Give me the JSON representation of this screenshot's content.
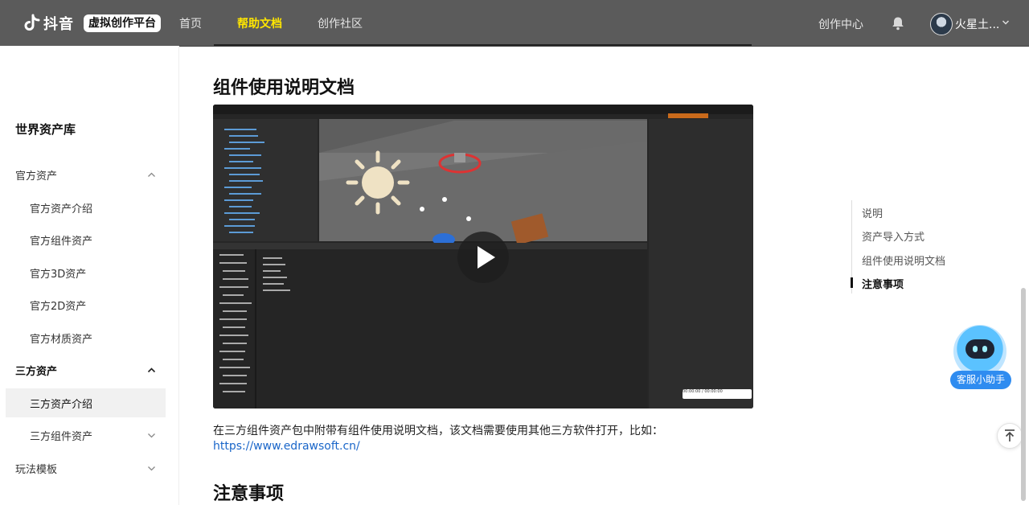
{
  "header": {
    "brand": "抖音",
    "badge": "虚拟创作平台",
    "nav": [
      "首页",
      "帮助文档",
      "创作社区"
    ],
    "active_nav": "帮助文档",
    "create_center": "创作中心",
    "username": "火星土..."
  },
  "sidebar": {
    "title": "世界资产库",
    "groups": [
      {
        "label": "官方资产",
        "expanded": true,
        "items": [
          "官方资产介绍",
          "官方组件资产",
          "官方3D资产",
          "官方2D资产",
          "官方材质资产"
        ]
      },
      {
        "label": "三方资产",
        "expanded": true,
        "items": [
          "三方资产介绍",
          "三方组件资产"
        ]
      },
      {
        "label": "玩法模板",
        "expanded": false,
        "items": []
      }
    ],
    "selected": "三方资产介绍"
  },
  "content": {
    "section_title": "组件使用说明文档",
    "video": {
      "time": "00:00:00 / 00:00:00"
    },
    "paragraph": "在三方组件资产包中附带有组件使用说明文档，该文档需要使用其他三方软件打开，比如：",
    "link": "https://www.edrawsoft.cn/",
    "next_title": "注意事项"
  },
  "toc": {
    "items": [
      "说明",
      "资产导入方式",
      "组件使用说明文档",
      "注意事项"
    ],
    "current": "注意事项"
  },
  "helper": {
    "label": "客服小助手"
  },
  "colors": {
    "header_bg": "#5b5b5b",
    "nav_active": "#ffe600",
    "link": "#1a66c9",
    "helper": "#2f8cf0"
  }
}
